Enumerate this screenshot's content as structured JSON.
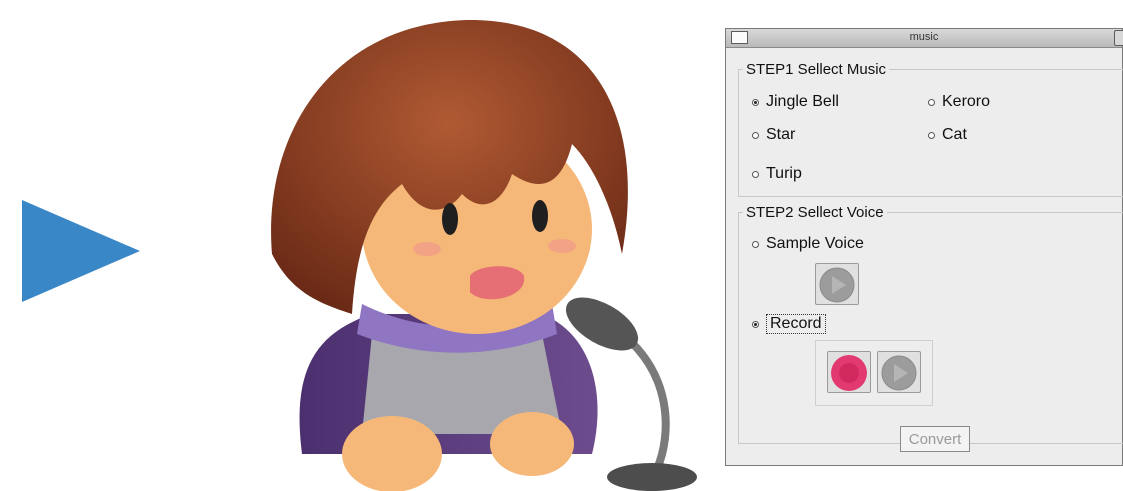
{
  "window": {
    "title": "music"
  },
  "step1": {
    "legend": "STEP1 Sellect Music",
    "options": [
      {
        "label": "Jingle Bell",
        "selected": true
      },
      {
        "label": "Keroro",
        "selected": false
      },
      {
        "label": "Star",
        "selected": false
      },
      {
        "label": "Cat",
        "selected": false
      },
      {
        "label": "Turip",
        "selected": false
      }
    ]
  },
  "step2": {
    "legend": "STEP2 Sellect Voice",
    "sample_label": "Sample Voice",
    "sample_selected": false,
    "record_label": "Record",
    "record_selected": true
  },
  "convert_label": "Convert",
  "colors": {
    "arrow": "#3a87c8",
    "record_button": "#e23a70",
    "play_button": "#9a9a9a"
  }
}
